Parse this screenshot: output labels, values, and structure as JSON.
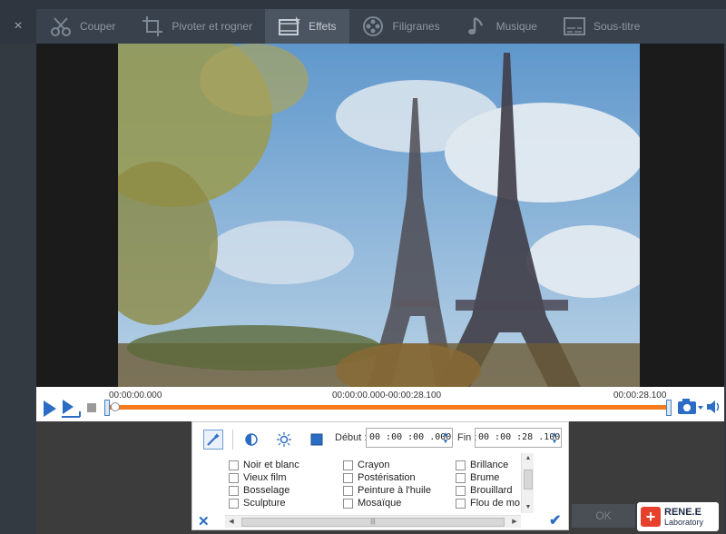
{
  "toolbar": {
    "close": "×",
    "tabs": [
      {
        "label": "Couper",
        "icon": "scissors-icon",
        "active": false
      },
      {
        "label": "Pivoter et rogner",
        "icon": "crop-icon",
        "active": false
      },
      {
        "label": "Effets",
        "icon": "film-effects-icon",
        "active": true
      },
      {
        "label": "Filigranes",
        "icon": "film-reel-icon",
        "active": false
      },
      {
        "label": "Musique",
        "icon": "music-note-icon",
        "active": false
      },
      {
        "label": "Sous-titre",
        "icon": "subtitle-icon",
        "active": false
      }
    ]
  },
  "timeline": {
    "start_time": "00:00:00.000",
    "range_time": "00:00:00.000-00:00:28.100",
    "end_time": "00:00:28.100",
    "accent_color": "#f47b20"
  },
  "effects_panel": {
    "start_label": "Début :",
    "start_value": "00 :00 :00 .000",
    "end_label": "Fin :",
    "end_value": "00 :00 :28 .100",
    "columns": [
      [
        "Noir et blanc",
        "Vieux film",
        "Bosselage",
        "Sculpture"
      ],
      [
        "Crayon",
        "Postérisation",
        "Peinture à l'huile",
        "Mosaïque"
      ],
      [
        "Brillance",
        "Brume",
        "Brouillard",
        "Flou de mo"
      ]
    ],
    "hscroll_grip": "|||"
  },
  "footer": {
    "ok_label": "OK",
    "logo_title": "RENE.E",
    "logo_sub": "Laboratory",
    "logo_mark": "+"
  }
}
